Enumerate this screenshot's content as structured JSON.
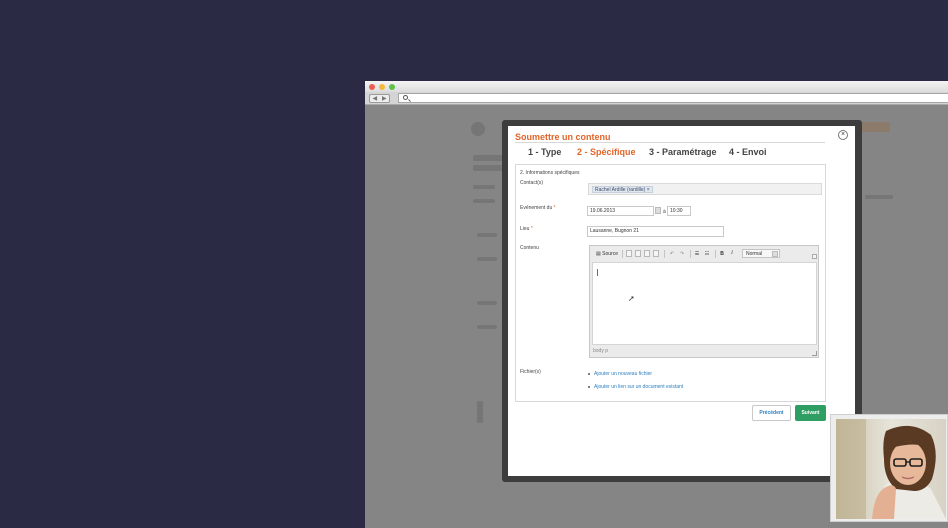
{
  "browser": {
    "back_glyph": "◀",
    "forward_glyph": "▶",
    "address_value": ""
  },
  "modal": {
    "title": "Soumettre un contenu",
    "close_glyph": "×",
    "steps": [
      {
        "label": "1 - Type",
        "active": false
      },
      {
        "label": "2 - Spécifique",
        "active": true
      },
      {
        "label": "3 - Paramétrage",
        "active": false
      },
      {
        "label": "4 - Envoi",
        "active": false
      }
    ],
    "section_title": "2. Informations spécifiques",
    "contacts": {
      "label": "Contact(s)",
      "tag": "Rachel Ardille (rardille)",
      "tag_remove": "×"
    },
    "event": {
      "label": "Evénement du",
      "required_mark": "*",
      "date_value": "19.06.2013",
      "separator": "à",
      "time_value": "10:30"
    },
    "place": {
      "label": "Lieu",
      "required_mark": "*",
      "value": "Lausanne, Bugnon 21"
    },
    "content": {
      "label": "Contenu",
      "toolbar": {
        "source_label": "Source",
        "bold_label": "B",
        "italic_label": "I",
        "format_value": "Normal"
      },
      "path": "body p"
    },
    "files": {
      "label": "Fichier(s)",
      "links": [
        "Ajouter un nouveau fichier",
        "Ajouter un lien sur un document existant"
      ]
    },
    "buttons": {
      "previous": "Précédent",
      "next": "Suivant"
    }
  },
  "colors": {
    "accent": "#e0652a",
    "link": "#2a7fc1",
    "primary_button": "#2f9e63",
    "desktop_bg": "#2b2a44"
  },
  "icons": {
    "mouse_cursor": "cursor-arrow-icon"
  }
}
